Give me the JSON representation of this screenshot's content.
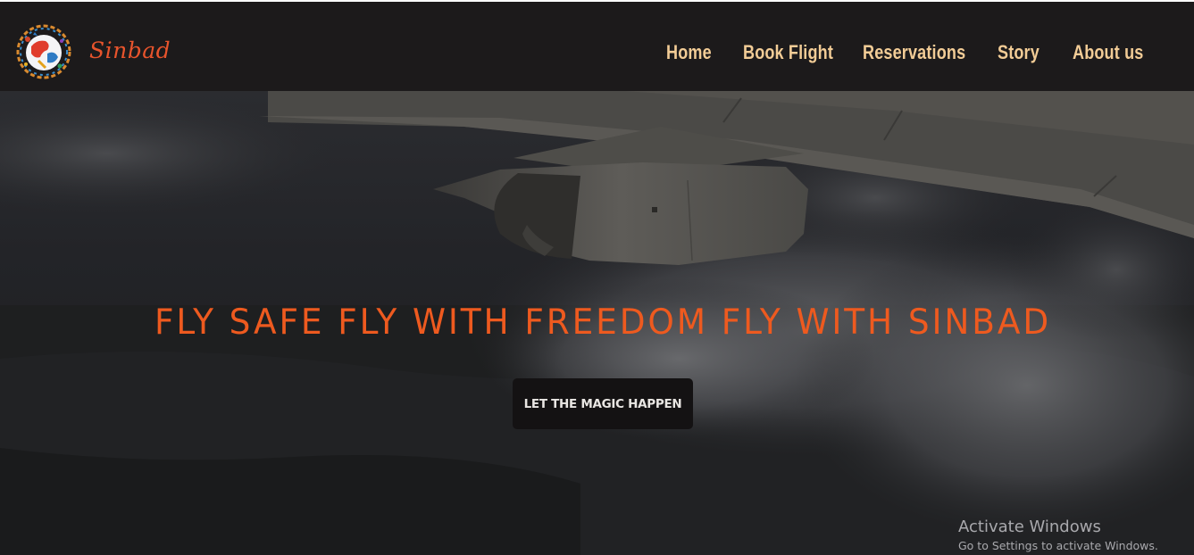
{
  "brand": {
    "name": "Sinbad",
    "logo_icon": "globe-logo-icon",
    "color": "#e8542c"
  },
  "nav": {
    "links": [
      {
        "label": "Home"
      },
      {
        "label": "Book Flight"
      },
      {
        "label": "Reservations"
      },
      {
        "label": "Story"
      },
      {
        "label": "About us"
      }
    ],
    "link_color": "#f2cc96",
    "background": "#1c1a1b"
  },
  "hero": {
    "headline": "FLY SAFE FLY WITH FREEDOM FLY WITH SINBAD",
    "headline_color": "#ee5a1f",
    "cta_label": "LET THE MAGIC HAPPEN",
    "background_image": "airplane-wing-over-clouds"
  },
  "watermark": {
    "title": "Activate Windows",
    "subtitle": "Go to Settings to activate Windows."
  }
}
